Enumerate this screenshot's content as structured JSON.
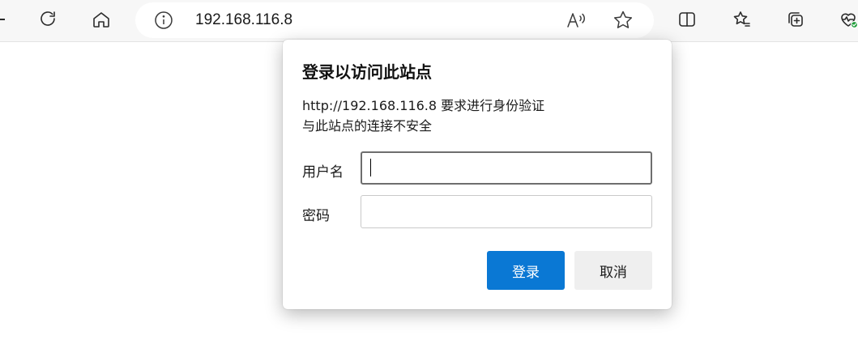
{
  "browser": {
    "address_url": "192.168.116.8",
    "toolbar_icons": [
      "refresh-icon",
      "home-icon",
      "info-icon",
      "read-aloud-icon",
      "favorite-star-icon",
      "split-screen-icon",
      "favorites-icon",
      "collections-icon",
      "browser-essentials-icon"
    ]
  },
  "dialog": {
    "title": "登录以访问此站点",
    "message_line1": "http://192.168.116.8 要求进行身份验证",
    "message_line2": "与此站点的连接不安全",
    "username_label": "用户名",
    "password_label": "密码",
    "username_value": "",
    "password_value": "",
    "login_label": "登录",
    "cancel_label": "取消"
  },
  "colors": {
    "login_button": "#0a78d4",
    "cancel_button": "#efefef",
    "status_badge": "#1f9d3a"
  }
}
